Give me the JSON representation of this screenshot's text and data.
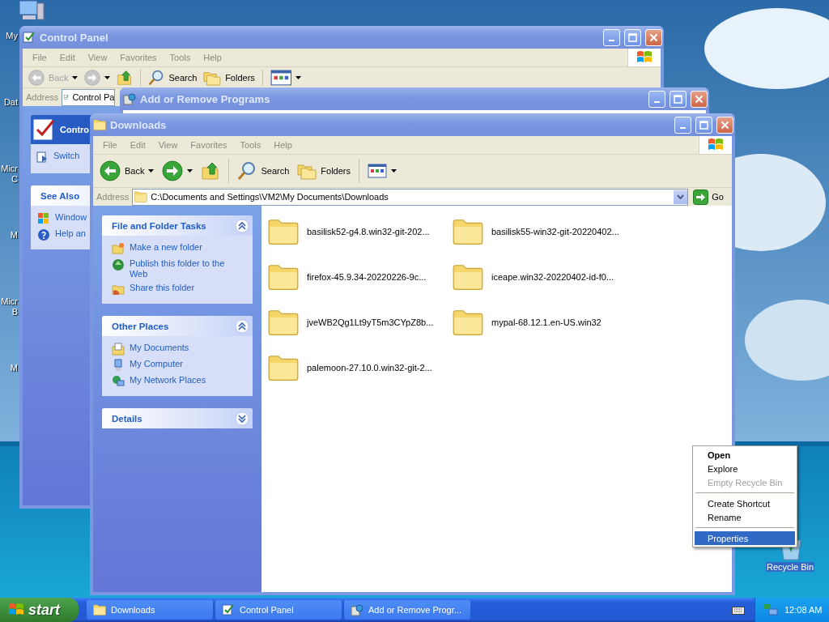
{
  "desktop_icons": [
    {
      "lines": [
        "My"
      ]
    },
    {
      "lines": [
        "Dat"
      ]
    },
    {
      "lines": [
        "Micr",
        "C"
      ]
    },
    {
      "lines": [
        "M"
      ]
    },
    {
      "lines": [
        "Micr",
        "B"
      ]
    },
    {
      "lines": [
        "M"
      ]
    }
  ],
  "windows": [
    {
      "kind": "control_panel",
      "title": "Control Panel",
      "active": false,
      "menu": [
        "File",
        "Edit",
        "View",
        "Favorites",
        "Tools",
        "Help"
      ],
      "toolbar": [
        {
          "kind": "back",
          "label": "Back",
          "disabled": true
        },
        {
          "kind": "forward",
          "disabled": true
        },
        {
          "kind": "up"
        },
        {
          "kind": "search",
          "label": "Search"
        },
        {
          "kind": "folders",
          "label": "Folders"
        },
        {
          "kind": "views"
        }
      ],
      "address_label": "Address",
      "address": "Control Pa",
      "header": "Contro",
      "header_link": "Switch",
      "see_also": {
        "title": "See Also",
        "links": [
          "Window",
          "Help an"
        ]
      }
    },
    {
      "kind": "dialog",
      "title": "Add or Remove Programs",
      "active": false
    },
    {
      "kind": "explorer",
      "title": "Downloads",
      "active": false,
      "menu": [
        "File",
        "Edit",
        "View",
        "Favorites",
        "Tools",
        "Help"
      ],
      "toolbar": [
        {
          "kind": "back",
          "label": "Back",
          "disabled": false
        },
        {
          "kind": "forward",
          "disabled": false
        },
        {
          "kind": "up"
        },
        {
          "kind": "search",
          "label": "Search"
        },
        {
          "kind": "folders",
          "label": "Folders"
        },
        {
          "kind": "views"
        }
      ],
      "address_label": "Address",
      "address": "C:\\Documents and Settings\\VM2\\My Documents\\Downloads",
      "go": "Go",
      "task_panes": [
        {
          "title": "File and Folder Tasks",
          "expanded": true,
          "items": [
            "Make a new folder",
            "Publish this folder to the Web",
            "Share this folder"
          ]
        },
        {
          "title": "Other Places",
          "expanded": true,
          "items": [
            "My Documents",
            "My Computer",
            "My Network Places"
          ]
        },
        {
          "title": "Details",
          "expanded": false
        }
      ],
      "files": [
        "basilisk52-g4.8.win32-git-202...",
        "basilisk55-win32-git-20220402...",
        "firefox-45.9.34-20220226-9c...",
        "iceape.win32-20220402-id-f0...",
        "jveWB2Qg1Lt9yT5m3CYpZ8b...",
        "mypal-68.12.1.en-US.win32",
        "palemoon-27.10.0.win32-git-2..."
      ]
    }
  ],
  "context_menu": [
    {
      "kind": "default",
      "label": "Open",
      "disabled": false,
      "selected": false
    },
    {
      "kind": "item",
      "label": "Explore",
      "disabled": false,
      "selected": false
    },
    {
      "kind": "item",
      "label": "Empty Recycle Bin",
      "disabled": true,
      "selected": false
    },
    {
      "kind": "separator"
    },
    {
      "kind": "item",
      "label": "Create Shortcut",
      "disabled": false,
      "selected": false
    },
    {
      "kind": "item",
      "label": "Rename",
      "disabled": false,
      "selected": false
    },
    {
      "kind": "separator"
    },
    {
      "kind": "item",
      "label": "Properties",
      "disabled": false,
      "selected": true
    }
  ],
  "recycle_bin": {
    "label": "Recycle Bin",
    "selected": true
  },
  "taskbar": {
    "start": "start",
    "tasks": [
      {
        "label": "Downloads",
        "selected": false
      },
      {
        "label": "Control Panel",
        "selected": false
      },
      {
        "label": "Add or Remove Progr...",
        "selected": false
      }
    ],
    "clock": "12:08 AM"
  }
}
